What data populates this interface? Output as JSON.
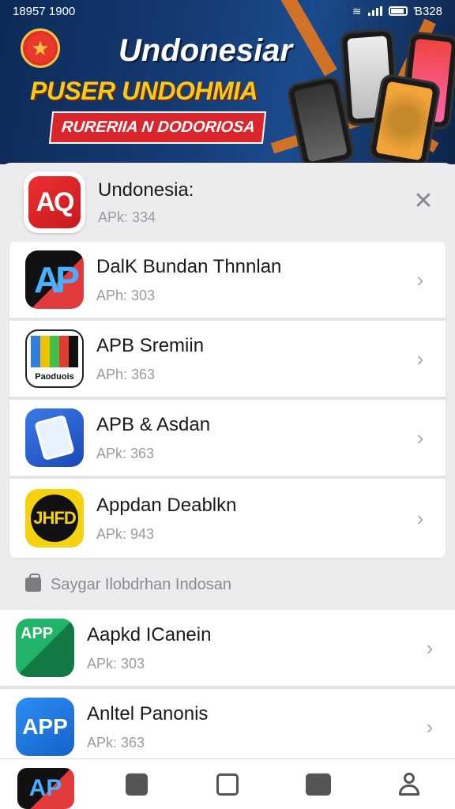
{
  "status_bar": {
    "time": "18957 1900",
    "right_text": "Ɓ328"
  },
  "banner": {
    "title": "Undonesiar",
    "subtitle": "PUSER UNDOHMIA",
    "tag": "RURERIIA N DODORIOSA"
  },
  "header": {
    "icon_text": "AQ",
    "title": "Undonesia:",
    "subtitle": "APk: 334",
    "close_label": "✕"
  },
  "apps": [
    {
      "title": "DalK Bundan Thnnlan",
      "subtitle": "APh: 303",
      "icon": "ap-red-icon",
      "icon_text": "AP"
    },
    {
      "title": "APB Sremiin",
      "subtitle": "APh: 363",
      "icon": "tv-colors-icon",
      "icon_text": "Paoduois"
    },
    {
      "title": "APB & Asdan",
      "subtitle": "APk: 363",
      "icon": "tablet-blue-icon",
      "icon_text": ""
    },
    {
      "title": "Appdan Deablkn",
      "subtitle": "APk: 943",
      "icon": "jhfd-yellow-icon",
      "icon_text": "JHFD"
    }
  ],
  "section": {
    "label": "Saygar Ilobdrhan Indosan",
    "icon": "bag-icon"
  },
  "more_apps": [
    {
      "title": "Aapkd ICanein",
      "subtitle": "APk: 303",
      "icon": "app-green-icon",
      "icon_text": "APP"
    },
    {
      "title": "Anltel Panonis",
      "subtitle": "APk: 363",
      "icon": "app-blue-icon",
      "icon_text": "APP"
    }
  ],
  "chevron": "›",
  "nav": {
    "items": [
      {
        "name": "nav-home",
        "icon": "ap-logo-icon",
        "label": "AP"
      },
      {
        "name": "nav-edit",
        "icon": "edit-icon"
      },
      {
        "name": "nav-bag",
        "icon": "bag-icon"
      },
      {
        "name": "nav-games",
        "icon": "gamepad-icon"
      },
      {
        "name": "nav-profile",
        "icon": "person-icon"
      }
    ]
  },
  "colors": {
    "banner_bg": "#163d78",
    "accent_orange": "#f07a18",
    "accent_yellow": "#f8c91c",
    "accent_red": "#d9252b"
  }
}
